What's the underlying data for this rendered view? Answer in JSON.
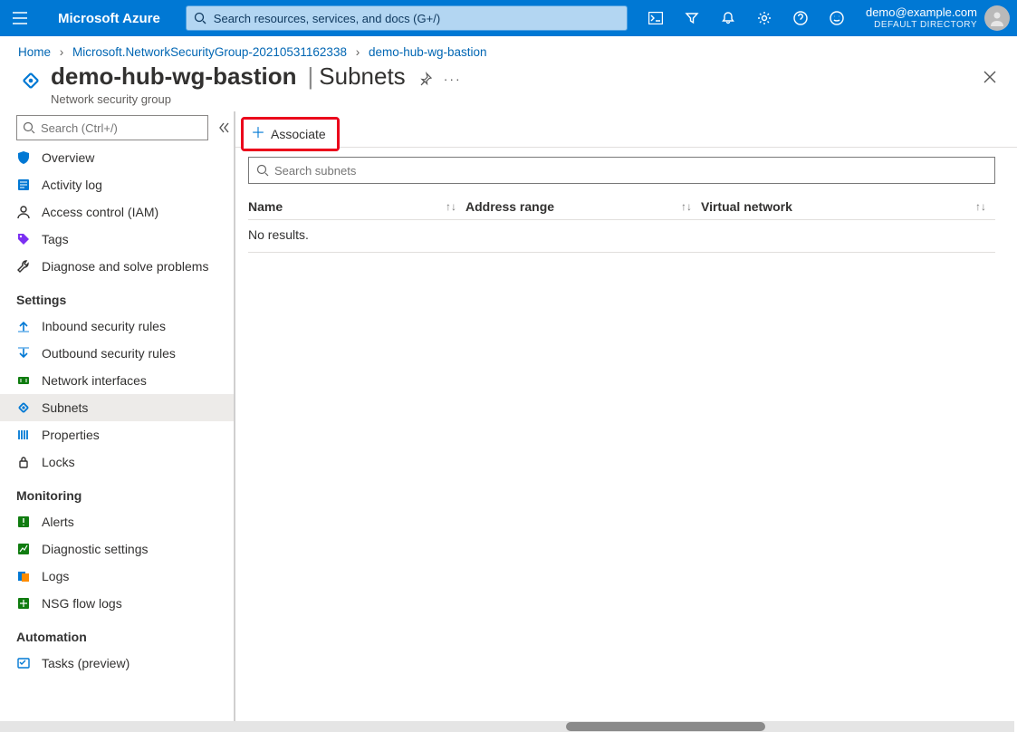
{
  "header": {
    "brand": "Microsoft Azure",
    "search_placeholder": "Search resources, services, and docs (G+/)",
    "account_email": "demo@example.com",
    "account_dir": "DEFAULT DIRECTORY"
  },
  "breadcrumb": {
    "items": [
      "Home",
      "Microsoft.NetworkSecurityGroup-20210531162338",
      "demo-hub-wg-bastion"
    ]
  },
  "title": {
    "name": "demo-hub-wg-bastion",
    "section": "Subnets",
    "subtitle": "Network security group"
  },
  "sidebar": {
    "search_placeholder": "Search (Ctrl+/)",
    "groups": [
      {
        "heading": "",
        "items": [
          {
            "label": "Overview",
            "icon": "shield",
            "color": "#0078d4"
          },
          {
            "label": "Activity log",
            "icon": "log",
            "color": "#0078d4"
          },
          {
            "label": "Access control (IAM)",
            "icon": "person",
            "color": "#323130"
          },
          {
            "label": "Tags",
            "icon": "tag",
            "color": "#7b2ff2"
          },
          {
            "label": "Diagnose and solve problems",
            "icon": "wrench",
            "color": "#323130"
          }
        ]
      },
      {
        "heading": "Settings",
        "items": [
          {
            "label": "Inbound security rules",
            "icon": "inbound",
            "color": "#0078d4"
          },
          {
            "label": "Outbound security rules",
            "icon": "outbound",
            "color": "#0078d4"
          },
          {
            "label": "Network interfaces",
            "icon": "nic",
            "color": "#107c10"
          },
          {
            "label": "Subnets",
            "icon": "subnets",
            "color": "#0078d4",
            "selected": true
          },
          {
            "label": "Properties",
            "icon": "properties",
            "color": "#0078d4"
          },
          {
            "label": "Locks",
            "icon": "lock",
            "color": "#323130"
          }
        ]
      },
      {
        "heading": "Monitoring",
        "items": [
          {
            "label": "Alerts",
            "icon": "alerts",
            "color": "#107c10"
          },
          {
            "label": "Diagnostic settings",
            "icon": "diag",
            "color": "#107c10"
          },
          {
            "label": "Logs",
            "icon": "logs",
            "color": "#0078d4"
          },
          {
            "label": "NSG flow logs",
            "icon": "flow",
            "color": "#107c10"
          }
        ]
      },
      {
        "heading": "Automation",
        "items": [
          {
            "label": "Tasks (preview)",
            "icon": "tasks",
            "color": "#0078d4"
          }
        ]
      }
    ]
  },
  "toolbar": {
    "associate_label": "Associate"
  },
  "main": {
    "search_placeholder": "Search subnets",
    "columns": [
      "Name",
      "Address range",
      "Virtual network"
    ],
    "no_results": "No results."
  }
}
